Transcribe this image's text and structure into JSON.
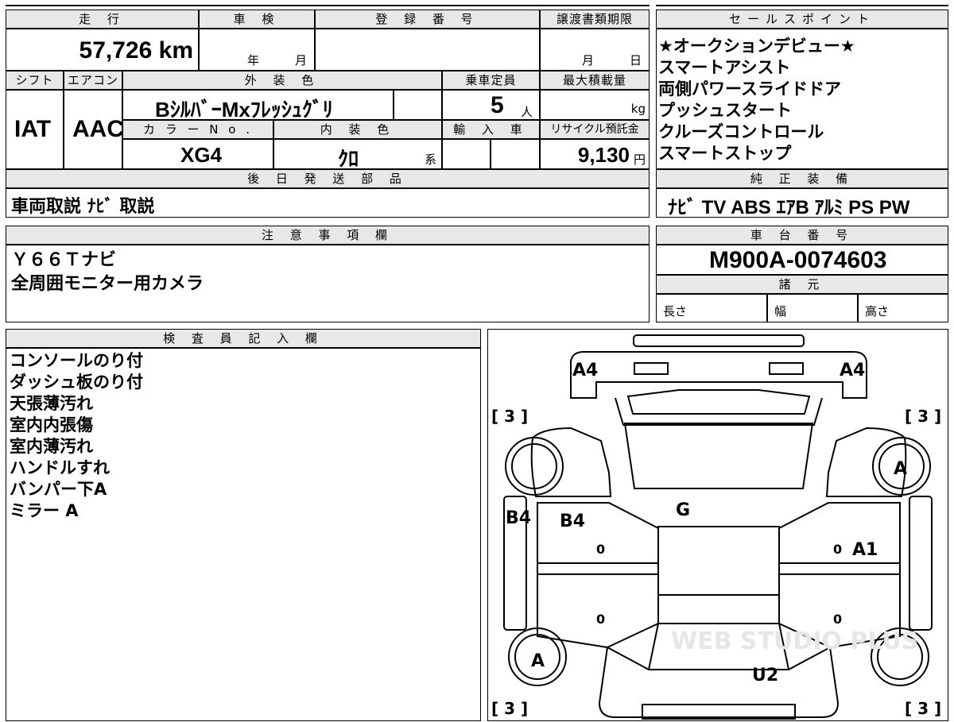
{
  "top_table": {
    "mileage_label": "走 行",
    "mileage_value": "57,726 km",
    "inspection_label": "車 検",
    "inspection_year": "年",
    "inspection_month": "月",
    "registration_label": "登 録 番 号",
    "transfer_label": "譲渡書類期限",
    "transfer_month": "月",
    "transfer_day": "日",
    "shift_label": "シフト",
    "shift_value": "IAT",
    "ac_label": "エアコン",
    "ac_value": "AAC",
    "exterior_label": "外 装 色",
    "exterior_value": "BｼﾙﾊﾞｰMxﾌﾚｯｼｭｸﾞﾘ",
    "capacity_label": "乗車定員",
    "capacity_value": "5",
    "capacity_unit": "人",
    "maxload_label": "最大積載量",
    "maxload_unit": "kg",
    "color_no_label": "カ ラ ー N o .",
    "color_no_value": "XG4",
    "interior_label": "内 装 色",
    "interior_value": "ｸﾛ",
    "interior_suffix": "系",
    "import_label": "輸 入 車",
    "recycle_label": "リサイクル預託金",
    "recycle_value": "9,130",
    "recycle_unit": "円"
  },
  "sales_points": {
    "label": "セールスポイント",
    "items": [
      "★オークションデビュー★",
      "スマートアシスト",
      "両側パワースライドドア",
      "プッシュスタート",
      "クルーズコントロール",
      "スマートストップ"
    ]
  },
  "later_parts": {
    "label": "後 日 発 送 部 品",
    "value": "車両取説 ﾅﾋﾞ 取説"
  },
  "genuine_equipment": {
    "label": "純 正 装 備",
    "value": "ﾅﾋﾞ TV ABS ｴｱB ｱﾙﾐ PS PW"
  },
  "notes": {
    "label": "注 意 事 項 欄",
    "lines": [
      "Ｙ６６Ｔナビ",
      "全周囲モニター用カメラ"
    ]
  },
  "chassis": {
    "label": "車 台 番 号",
    "value": "M900A-0074603"
  },
  "specs": {
    "label": "諸 元",
    "length": "長さ",
    "width": "幅",
    "height": "高さ"
  },
  "inspector": {
    "label": "検 査 員 記 入 欄",
    "lines": [
      "コンソールのり付",
      "ダッシュ板のり付",
      "天張薄汚れ",
      "室内内張傷",
      "室内薄汚れ",
      "ハンドルすれ",
      "バンパー下A",
      "ミラー A"
    ]
  },
  "diagram": {
    "marks": {
      "front_left": "A4",
      "front_right": "A4",
      "bracket_tl": "[ 3 ]",
      "bracket_tr": "[ 3 ]",
      "bracket_bl": "[ 3 ]",
      "bracket_br": "[ 3 ]",
      "wheel_fr": "A",
      "wheel_rl": "A",
      "side_left": "B4",
      "door_fl": "B4",
      "windshield": "G",
      "door_fr": "A1",
      "rear": "U2",
      "zero_1": "0",
      "zero_2": "0",
      "zero_3": "0",
      "zero_4": "0"
    },
    "watermark": "WEB STUDIO PLUS"
  }
}
